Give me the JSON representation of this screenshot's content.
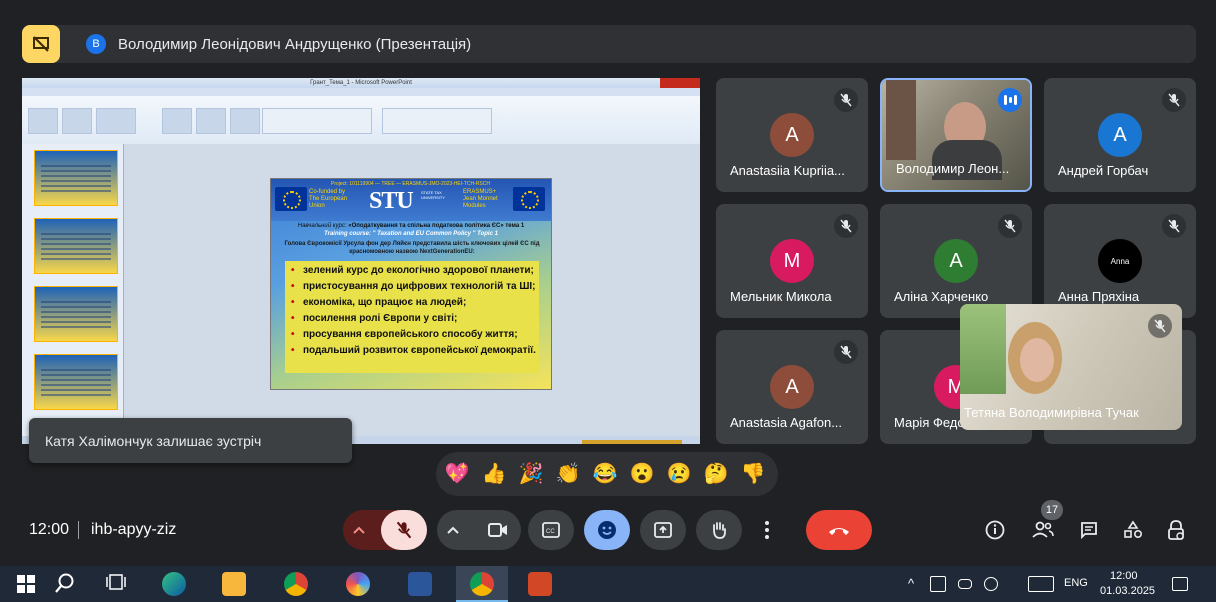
{
  "presentation_bar": {
    "avatar_letter": "В",
    "title": "Володимир Леонідович Андрущенко (Презентація)"
  },
  "shared_screen": {
    "window_title": "Грант_Тема_1 - Microsoft PowerPoint",
    "slide": {
      "header_line": "Project: 101119904 — TREE — ERASMUS-JMO-2023-HEI-TCH-RSCH",
      "eu_text": "Co-funded by The European Union",
      "logo_text": "STU",
      "logo_sub": "STATE TAX UNIVERSITY",
      "erasmus_text": "ERASMUS+ Jean Monnet Modules",
      "course_label": "Навчальний курс:",
      "course_title": "«Оподаткування та спільна податкова політика ЄС» тема 1",
      "training": "Training course: \" Taxation and EU Common Policy \" Topic 1",
      "intro": "Голова Єврокомісії Урсула фон дер Ляйєн представила шість ключових цілей ЄС під красномовною назвою NextGenerationEU:",
      "bullets": [
        "зелений курс до екологічно здорової планети;",
        "пристосування до цифрових технологій та ШІ;",
        "економіка, що працює на людей;",
        "посилення ролі Європи у світі;",
        "просування європейського способу життя;",
        "подальший розвиток європейської демократії."
      ]
    }
  },
  "toast": "Катя Халімончук залишає зустріч",
  "participants": [
    {
      "name": "Anastasiia Kupriia...",
      "letter": "A",
      "color": "#8d4d3a"
    },
    {
      "name": "Володимир Леон...",
      "letter": "",
      "color": "#6b6f60"
    },
    {
      "name": "Андрей Горбач",
      "letter": "A",
      "color": "#1976d2"
    },
    {
      "name": "Мельник Микола",
      "letter": "M",
      "color": "#d81b60"
    },
    {
      "name": "Аліна Харченко",
      "letter": "A",
      "color": "#2e7d32"
    },
    {
      "name": "Анна Пряхіна",
      "letter": "Anna",
      "color": "#000000"
    },
    {
      "name": "Anastasia Agafon...",
      "letter": "A",
      "color": "#8d4d3a"
    },
    {
      "name": "Марія Федо",
      "letter": "M",
      "color": "#d81b60"
    }
  ],
  "floating_self": {
    "name": "Тетяна Володимирівна Тучак"
  },
  "reactions": [
    "💖",
    "👍",
    "🎉",
    "👏",
    "😂",
    "😮",
    "😢",
    "🤔",
    "👎"
  ],
  "bottom": {
    "time": "12:00",
    "code": "ihb-apyy-ziz",
    "participant_count": "17"
  },
  "taskbar": {
    "lang": "ENG",
    "time": "12:00",
    "date": "01.03.2025"
  },
  "colors": {
    "accent": "#8ab4f8",
    "end_call": "#ea4335",
    "mic_off": "#f28b82",
    "present_badge": "#fdd663"
  }
}
